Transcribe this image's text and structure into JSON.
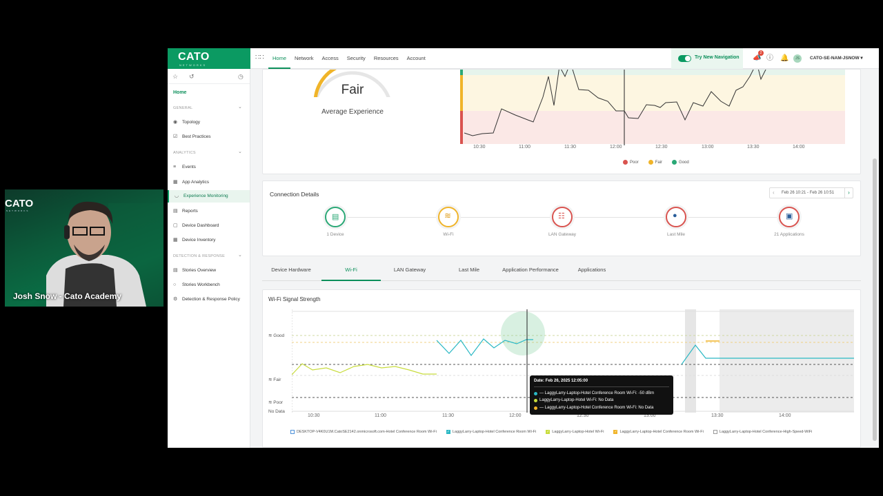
{
  "topbar": {
    "logo": "CATO",
    "logo_sub": "NETWORKS",
    "nav": [
      "Home",
      "Network",
      "Access",
      "Security",
      "Resources",
      "Account"
    ],
    "try_new_nav": "Try New Navigation",
    "notif_count": "2",
    "avatar_initials": "JS",
    "account": "CATO-SE-NAM-JSNOW"
  },
  "sidebar": {
    "home": "Home",
    "sections": [
      {
        "title": "GENERAL",
        "items": [
          "Topology",
          "Best Practices"
        ]
      },
      {
        "title": "ANALYTICS",
        "items": [
          "Events",
          "App Analytics",
          "Experience Monitoring",
          "Reports",
          "Device Dashboard",
          "Device Inventory"
        ]
      },
      {
        "title": "DETECTION & RESPONSE",
        "items": [
          "Stories Overview",
          "Stories Workbench",
          "Detection & Response Policy"
        ]
      }
    ],
    "active_item": "Experience Monitoring"
  },
  "experience": {
    "gauge_value": "Fair",
    "gauge_label": "Average Experience",
    "x_ticks": [
      "10:30",
      "11:00",
      "11:30",
      "12:00",
      "12:30",
      "13:00",
      "13:30",
      "14:00"
    ],
    "legend": [
      {
        "label": "Poor",
        "color": "#d9534f"
      },
      {
        "label": "Fair",
        "color": "#f0b429"
      },
      {
        "label": "Good",
        "color": "#2aa876"
      }
    ]
  },
  "connection": {
    "title": "Connection Details",
    "date_range": "Feb 26 10:21 - Feb 26 10:51",
    "nodes": [
      {
        "label": "1 Device",
        "color": "#2aa876",
        "icon": "monitor-icon"
      },
      {
        "label": "Wi-Fi",
        "color": "#f0b429",
        "icon": "wifi-icon"
      },
      {
        "label": "LAN Gateway",
        "color": "#d9534f",
        "icon": "gateway-icon"
      },
      {
        "label": "Last Mile",
        "color": "#d9534f",
        "icon": "location-pin-icon"
      },
      {
        "label": "21 Applications",
        "color": "#d9534f",
        "icon": "cube-icon"
      }
    ]
  },
  "tabs": [
    "Device Hardware",
    "Wi-Fi",
    "LAN Gateway",
    "Last Mile",
    "Application Performance",
    "Applications"
  ],
  "active_tab": "Wi-Fi",
  "wifi": {
    "title": "Wi-Fi Signal Strength",
    "y_labels": [
      "Good",
      "Fair",
      "Poor",
      "No Data"
    ],
    "x_ticks": [
      "10:30",
      "11:00",
      "11:30",
      "12:00",
      "12:30",
      "13:00",
      "13:30",
      "14:00"
    ],
    "tooltip": {
      "date": "Date: Feb 26, 2025 12:05:00",
      "rows": [
        {
          "text": "— LaggyLarry-Laptop-Hotel Conference Room Wi-Fi: -50 dBm",
          "color": "#2ab8c4"
        },
        {
          "text": "LaggyLarry-Laptop-Hotel Wi-Fi: No Data",
          "color": "#c8dc3c"
        },
        {
          "text": "— LaggyLarry-Laptop-Hotel Conference Room Wi-Fi: No Data",
          "color": "#f0b429"
        }
      ]
    },
    "legend": [
      {
        "label": "DESKTOP-V4K0U1M.CatoSE2142.onmicrosoft.com-Hotel Conference Room Wi-Fi",
        "color": "#4a8fd8",
        "checked": false
      },
      {
        "label": "LaggyLarry-Laptop-Hotel Conference Room Wi-Fi",
        "color": "#2ab8c4",
        "checked": true
      },
      {
        "label": "LaggyLarry-Laptop-Hotel Wi-Fi",
        "color": "#c8dc3c",
        "checked": true
      },
      {
        "label": "LaggyLarry-Laptop-Hotel Conference Room Wi-Fi",
        "color": "#f0b429",
        "checked": true
      },
      {
        "label": "LaggyLarry-Laptop-Hotel Conference-High-Speed-WiFi",
        "color": "#999999",
        "checked": false
      }
    ]
  },
  "video": {
    "logo": "CATO",
    "logo_sub": "NETWORKS",
    "caption": "Josh Snow - Cato Academy"
  }
}
